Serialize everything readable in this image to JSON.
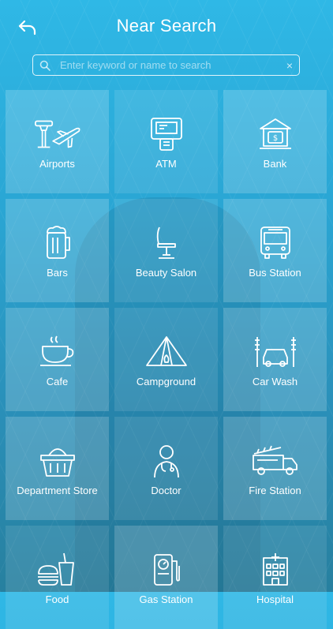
{
  "header": {
    "title": "Near Search",
    "back_icon": "back-arrow-icon"
  },
  "search": {
    "placeholder": "Enter keyword or name to search",
    "value": "",
    "clear_label": "×"
  },
  "categories": [
    {
      "label": "Airports",
      "icon": "airport-icon"
    },
    {
      "label": "ATM",
      "icon": "atm-icon"
    },
    {
      "label": "Bank",
      "icon": "bank-icon"
    },
    {
      "label": "Bars",
      "icon": "beer-icon"
    },
    {
      "label": "Beauty Salon",
      "icon": "salon-chair-icon"
    },
    {
      "label": "Bus Station",
      "icon": "bus-icon"
    },
    {
      "label": "Cafe",
      "icon": "coffee-cup-icon"
    },
    {
      "label": "Campground",
      "icon": "tent-icon"
    },
    {
      "label": "Car Wash",
      "icon": "car-wash-icon"
    },
    {
      "label": "Department Store",
      "icon": "shopping-basket-icon"
    },
    {
      "label": "Doctor",
      "icon": "doctor-icon"
    },
    {
      "label": "Fire Station",
      "icon": "fire-truck-icon"
    },
    {
      "label": "Food",
      "icon": "fast-food-icon"
    },
    {
      "label": "Gas Station",
      "icon": "gas-pump-icon"
    },
    {
      "label": "Hospital",
      "icon": "hospital-icon"
    }
  ],
  "colors": {
    "background_top": "#2fb8e6",
    "background_bottom": "#27809f",
    "text": "#ffffff"
  }
}
